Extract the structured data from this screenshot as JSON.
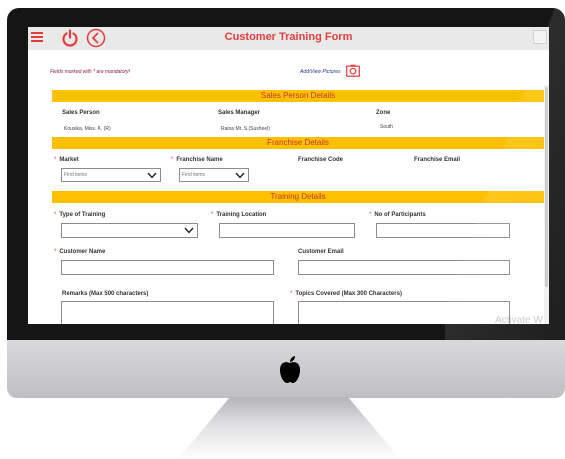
{
  "header": {
    "title": "Customer Training Form"
  },
  "notes": {
    "mandatory": "Fields marked with * are mandatory!",
    "add_pictures": "Add/View Pictures"
  },
  "sales": {
    "heading": "Sales Person Details",
    "person_label": "Sales Person",
    "person_value": "Kousika, Miss. K. (R)",
    "manager_label": "Sales Manager",
    "manager_value": "Raina Mr. S.(Susheel)",
    "zone_label": "Zone",
    "zone_value": "South"
  },
  "franchise": {
    "heading": "Franchise Details",
    "market_label": "Market",
    "market_placeholder": "Find items",
    "name_label": "Franchise Name",
    "name_placeholder": "Find items",
    "code_label": "Franchise Code",
    "email_label": "Franchise Email"
  },
  "training": {
    "heading": "Training Details",
    "type_label": "Type of Training",
    "location_label": "Training Location",
    "participants_label": "No of Participants",
    "customer_name_label": "Customer Name",
    "customer_email_label": "Customer Email",
    "remarks_label": "Remarks (Max 500 characters)",
    "topics_label": "Topics Covered (Max 300 Characters)"
  },
  "required_mark": "*",
  "watermark": "Activate W",
  "colors": {
    "accent_red": "#e23d3d",
    "section_bar": "#ffc000",
    "section_text": "#c0392b"
  },
  "icons": {
    "menu": "hamburger-menu-icon",
    "power": "power-icon",
    "back": "back-arrow-icon",
    "camera": "camera-icon",
    "apple": "apple-logo"
  }
}
